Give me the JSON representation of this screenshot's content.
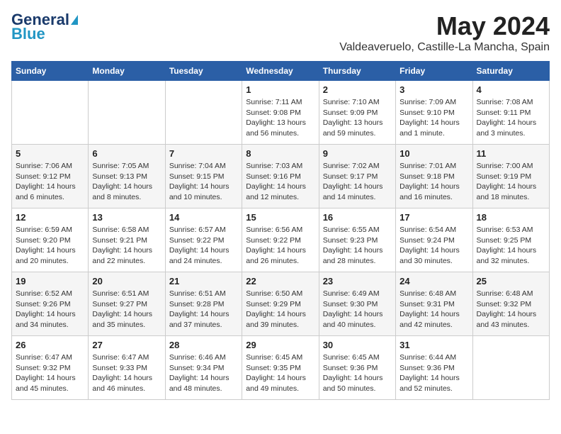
{
  "header": {
    "logo_general": "General",
    "logo_blue": "Blue",
    "month_title": "May 2024",
    "location": "Valdeaveruelo, Castille-La Mancha, Spain"
  },
  "days_of_week": [
    "Sunday",
    "Monday",
    "Tuesday",
    "Wednesday",
    "Thursday",
    "Friday",
    "Saturday"
  ],
  "weeks": [
    [
      {
        "day": "",
        "info": ""
      },
      {
        "day": "",
        "info": ""
      },
      {
        "day": "",
        "info": ""
      },
      {
        "day": "1",
        "info": "Sunrise: 7:11 AM\nSunset: 9:08 PM\nDaylight: 13 hours\nand 56 minutes."
      },
      {
        "day": "2",
        "info": "Sunrise: 7:10 AM\nSunset: 9:09 PM\nDaylight: 13 hours\nand 59 minutes."
      },
      {
        "day": "3",
        "info": "Sunrise: 7:09 AM\nSunset: 9:10 PM\nDaylight: 14 hours\nand 1 minute."
      },
      {
        "day": "4",
        "info": "Sunrise: 7:08 AM\nSunset: 9:11 PM\nDaylight: 14 hours\nand 3 minutes."
      }
    ],
    [
      {
        "day": "5",
        "info": "Sunrise: 7:06 AM\nSunset: 9:12 PM\nDaylight: 14 hours\nand 6 minutes."
      },
      {
        "day": "6",
        "info": "Sunrise: 7:05 AM\nSunset: 9:13 PM\nDaylight: 14 hours\nand 8 minutes."
      },
      {
        "day": "7",
        "info": "Sunrise: 7:04 AM\nSunset: 9:15 PM\nDaylight: 14 hours\nand 10 minutes."
      },
      {
        "day": "8",
        "info": "Sunrise: 7:03 AM\nSunset: 9:16 PM\nDaylight: 14 hours\nand 12 minutes."
      },
      {
        "day": "9",
        "info": "Sunrise: 7:02 AM\nSunset: 9:17 PM\nDaylight: 14 hours\nand 14 minutes."
      },
      {
        "day": "10",
        "info": "Sunrise: 7:01 AM\nSunset: 9:18 PM\nDaylight: 14 hours\nand 16 minutes."
      },
      {
        "day": "11",
        "info": "Sunrise: 7:00 AM\nSunset: 9:19 PM\nDaylight: 14 hours\nand 18 minutes."
      }
    ],
    [
      {
        "day": "12",
        "info": "Sunrise: 6:59 AM\nSunset: 9:20 PM\nDaylight: 14 hours\nand 20 minutes."
      },
      {
        "day": "13",
        "info": "Sunrise: 6:58 AM\nSunset: 9:21 PM\nDaylight: 14 hours\nand 22 minutes."
      },
      {
        "day": "14",
        "info": "Sunrise: 6:57 AM\nSunset: 9:22 PM\nDaylight: 14 hours\nand 24 minutes."
      },
      {
        "day": "15",
        "info": "Sunrise: 6:56 AM\nSunset: 9:22 PM\nDaylight: 14 hours\nand 26 minutes."
      },
      {
        "day": "16",
        "info": "Sunrise: 6:55 AM\nSunset: 9:23 PM\nDaylight: 14 hours\nand 28 minutes."
      },
      {
        "day": "17",
        "info": "Sunrise: 6:54 AM\nSunset: 9:24 PM\nDaylight: 14 hours\nand 30 minutes."
      },
      {
        "day": "18",
        "info": "Sunrise: 6:53 AM\nSunset: 9:25 PM\nDaylight: 14 hours\nand 32 minutes."
      }
    ],
    [
      {
        "day": "19",
        "info": "Sunrise: 6:52 AM\nSunset: 9:26 PM\nDaylight: 14 hours\nand 34 minutes."
      },
      {
        "day": "20",
        "info": "Sunrise: 6:51 AM\nSunset: 9:27 PM\nDaylight: 14 hours\nand 35 minutes."
      },
      {
        "day": "21",
        "info": "Sunrise: 6:51 AM\nSunset: 9:28 PM\nDaylight: 14 hours\nand 37 minutes."
      },
      {
        "day": "22",
        "info": "Sunrise: 6:50 AM\nSunset: 9:29 PM\nDaylight: 14 hours\nand 39 minutes."
      },
      {
        "day": "23",
        "info": "Sunrise: 6:49 AM\nSunset: 9:30 PM\nDaylight: 14 hours\nand 40 minutes."
      },
      {
        "day": "24",
        "info": "Sunrise: 6:48 AM\nSunset: 9:31 PM\nDaylight: 14 hours\nand 42 minutes."
      },
      {
        "day": "25",
        "info": "Sunrise: 6:48 AM\nSunset: 9:32 PM\nDaylight: 14 hours\nand 43 minutes."
      }
    ],
    [
      {
        "day": "26",
        "info": "Sunrise: 6:47 AM\nSunset: 9:32 PM\nDaylight: 14 hours\nand 45 minutes."
      },
      {
        "day": "27",
        "info": "Sunrise: 6:47 AM\nSunset: 9:33 PM\nDaylight: 14 hours\nand 46 minutes."
      },
      {
        "day": "28",
        "info": "Sunrise: 6:46 AM\nSunset: 9:34 PM\nDaylight: 14 hours\nand 48 minutes."
      },
      {
        "day": "29",
        "info": "Sunrise: 6:45 AM\nSunset: 9:35 PM\nDaylight: 14 hours\nand 49 minutes."
      },
      {
        "day": "30",
        "info": "Sunrise: 6:45 AM\nSunset: 9:36 PM\nDaylight: 14 hours\nand 50 minutes."
      },
      {
        "day": "31",
        "info": "Sunrise: 6:44 AM\nSunset: 9:36 PM\nDaylight: 14 hours\nand 52 minutes."
      },
      {
        "day": "",
        "info": ""
      }
    ]
  ]
}
